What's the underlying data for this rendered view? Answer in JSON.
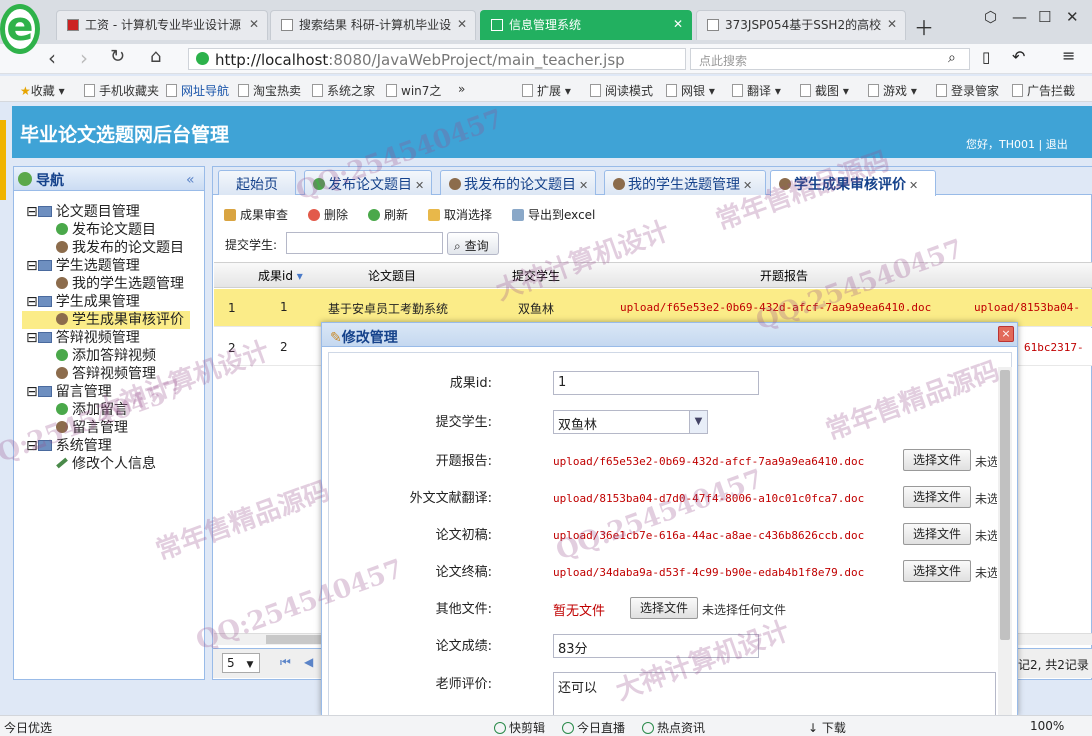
{
  "browser": {
    "tabs": [
      {
        "label": "工资 - 计算机专业毕业设计源"
      },
      {
        "label": "搜索结果 科研-计算机毕业设"
      },
      {
        "label": "信息管理系统"
      },
      {
        "label": "373JSP054基于SSH2的高校"
      }
    ],
    "logo": "e",
    "url_host": "http://localhost",
    "url_path": ":8080/JavaWebProject/main_teacher.jsp",
    "search_placeholder": "点此搜索",
    "bookmarks": [
      "收藏",
      "手机收藏夹",
      "网址导航",
      "淘宝热卖",
      "系统之家",
      "win7之",
      "»"
    ],
    "bookmarks_right": [
      "扩展",
      "阅读模式",
      "网银",
      "翻译",
      "截图",
      "游戏",
      "登录管家",
      "广告拦截"
    ]
  },
  "app": {
    "title": "毕业论文选题网后台管理",
    "greeting": "您好，TH001",
    "separator": "|",
    "logout": "退出"
  },
  "sidebar": {
    "title": "导航",
    "collapse_glyph": "«",
    "items": [
      {
        "label": "论文题目管理"
      },
      {
        "label": "发布论文题目"
      },
      {
        "label": "我发布的论文题目"
      },
      {
        "label": "学生选题管理"
      },
      {
        "label": "我的学生选题管理"
      },
      {
        "label": "学生成果管理"
      },
      {
        "label": "学生成果审核评价"
      },
      {
        "label": "答辩视频管理"
      },
      {
        "label": "添加答辩视频"
      },
      {
        "label": "答辩视频管理"
      },
      {
        "label": "留言管理"
      },
      {
        "label": "添加留言"
      },
      {
        "label": "留言管理"
      },
      {
        "label": "系统管理"
      },
      {
        "label": "修改个人信息"
      }
    ]
  },
  "tabs": [
    {
      "label": "起始页"
    },
    {
      "label": "发布论文题目"
    },
    {
      "label": "我发布的论文题目"
    },
    {
      "label": "我的学生选题管理"
    },
    {
      "label": "学生成果审核评价"
    }
  ],
  "toolbar": {
    "review": "成果审查",
    "delete": "删除",
    "refresh": "刷新",
    "cancel": "取消选择",
    "export": "导出到excel",
    "query_label": "提交学生:",
    "query_btn": "查询"
  },
  "grid": {
    "columns": [
      "成果id",
      "论文题目",
      "提交学生",
      "开题报告"
    ],
    "rows": [
      {
        "num": "1",
        "id": "1",
        "title": "基于安卓员工考勤系统",
        "student": "双鱼林",
        "report": "upload/f65e53e2-0b69-432d-afcf-7aa9a9ea6410.doc",
        "extra": "upload/8153ba04-"
      },
      {
        "num": "2",
        "id": "2",
        "title": "",
        "student": "",
        "report": "",
        "extra": "61bc2317-"
      }
    ],
    "page_size": "5",
    "page_info": "记2, 共2记录"
  },
  "dialog": {
    "title": "修改管理",
    "close": "×",
    "fields": {
      "id_label": "成果id:",
      "id_value": "1",
      "student_label": "提交学生:",
      "student_value": "双鱼林",
      "report_label": "开题报告:",
      "report_value": "upload/f65e53e2-0b69-432d-afcf-7aa9a9ea6410.doc",
      "trans_label": "外文文献翻译:",
      "trans_value": "upload/8153ba04-d7d0-47f4-8006-a10c01c0fca7.doc",
      "draft_label": "论文初稿:",
      "draft_value": "upload/36e1cb7e-616a-44ac-a8ae-c436b8626ccb.doc",
      "final_label": "论文终稿:",
      "final_value": "upload/34daba9a-d53f-4c99-b90e-edab4b1f8e79.doc",
      "other_label": "其他文件:",
      "other_value": "暂无文件",
      "score_label": "论文成绩:",
      "score_value": "83分",
      "comment_label": "老师评价:",
      "comment_value": "还可以"
    },
    "choose_file": "选择文件",
    "no_file": "未选择任何文件",
    "no_file_short": "未选"
  },
  "statusbar": {
    "left": "今日优选",
    "items": [
      "快剪辑",
      "今日直播",
      "热点资讯",
      "下载"
    ],
    "zoom": "100%"
  },
  "watermarks": [
    "QQ:254540457",
    "大神计算机设计",
    "常年售精品源码"
  ],
  "colors": {
    "header": "#3fa3d6",
    "selected_row": "#fbec88",
    "active_tab": "#22b060",
    "link_red": "#c00000"
  }
}
